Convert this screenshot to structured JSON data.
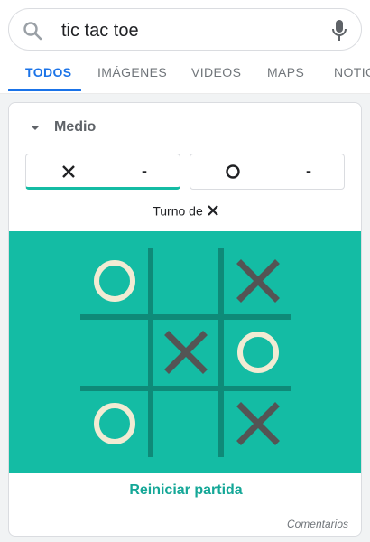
{
  "search": {
    "query": "tic tac toe",
    "icons": {
      "left": "search-icon",
      "right": "microphone-icon"
    }
  },
  "tabs": [
    {
      "label": "TODOS",
      "active": true
    },
    {
      "label": "IMÁGENES",
      "active": false
    },
    {
      "label": "VIDEOS",
      "active": false
    },
    {
      "label": "MAPS",
      "active": false
    },
    {
      "label": "NOTIC",
      "active": false
    }
  ],
  "game": {
    "difficulty": "Medio",
    "players": [
      {
        "symbol": "X",
        "score": "-"
      },
      {
        "symbol": "O",
        "score": "-"
      }
    ],
    "turn_label": "Turno de",
    "turn_symbol": "X",
    "board": [
      [
        "O",
        "",
        "X"
      ],
      [
        "",
        "X",
        "O"
      ],
      [
        "O",
        "",
        "X"
      ]
    ],
    "reset_label": "Reiniciar partida",
    "feedback_label": "Comentarios"
  },
  "colors": {
    "accent": "#1a73e8",
    "board_bg": "#14bca4",
    "grid_line": "#0e8a78",
    "x_mark": "#545454",
    "o_mark": "#f2ebd3",
    "reset_text": "#14a797"
  }
}
